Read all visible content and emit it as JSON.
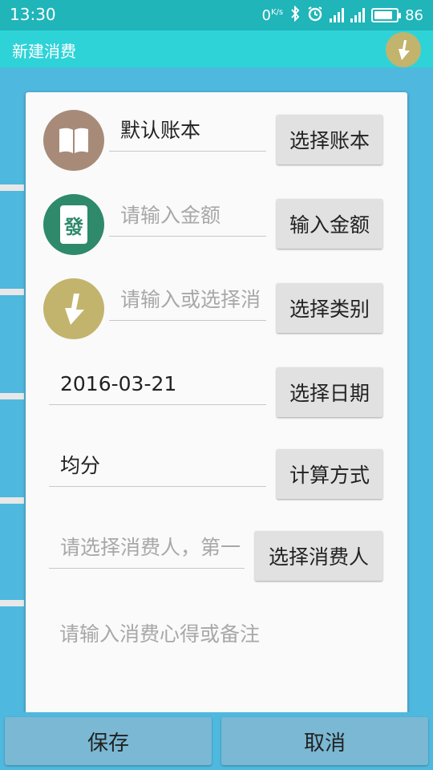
{
  "status_bar": {
    "time": "13:30",
    "speed": "0",
    "speed_unit": "K/s",
    "battery": "86"
  },
  "action_bar": {
    "title": "新建消费",
    "icon": "arrow-down-circle-icon"
  },
  "form": {
    "account": {
      "value": "默认账本",
      "button": "选择账本",
      "icon": "book-icon"
    },
    "amount": {
      "placeholder": "请输入金额",
      "button": "输入金额",
      "icon": "mahjong-fa-icon",
      "icon_glyph": "發"
    },
    "category": {
      "placeholder": "请输入或选择消",
      "button": "选择类别",
      "icon": "arrow-down-circle-icon"
    },
    "date": {
      "value": "2016-03-21",
      "button": "选择日期"
    },
    "calc": {
      "value": "均分",
      "button": "计算方式"
    },
    "consumers": {
      "placeholder": "请选择消费人，第一",
      "button": "选择消费人"
    },
    "note": {
      "placeholder": "请输入消费心得或备注"
    }
  },
  "bottom": {
    "save": "保存",
    "cancel": "取消"
  },
  "colors": {
    "status_bar": "#1fb5b9",
    "action_bar": "#2ed3d8",
    "background": "#4fb8de",
    "book_avatar": "#a78b78",
    "amount_avatar": "#2e8a6a",
    "category_avatar": "#c2b46c"
  }
}
